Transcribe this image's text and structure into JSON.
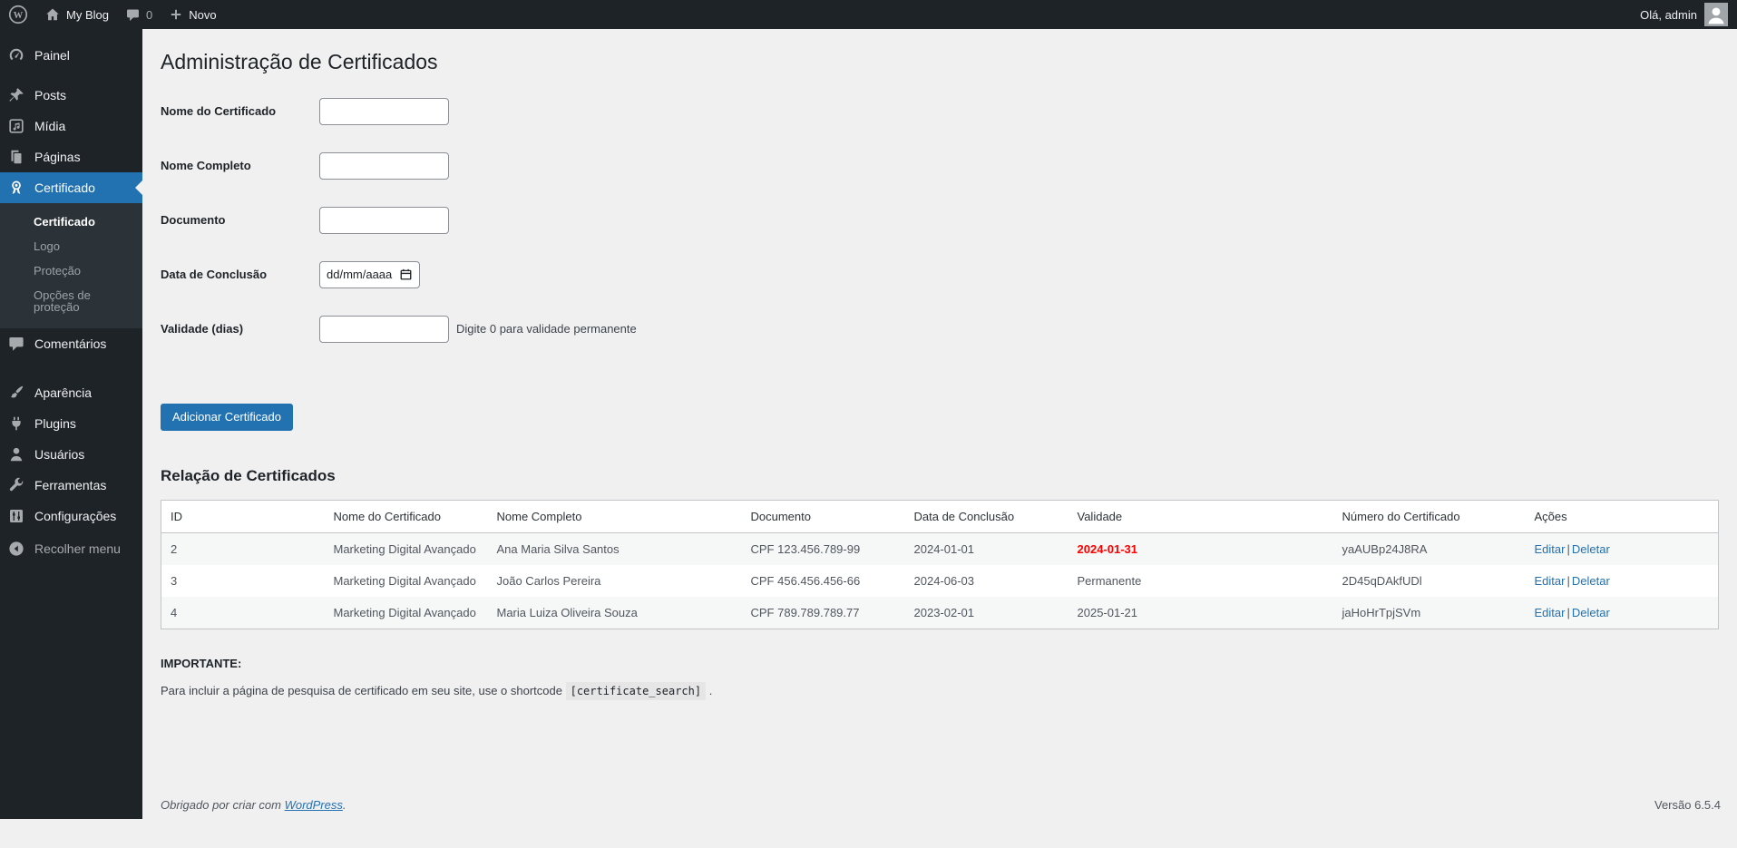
{
  "admin_bar": {
    "site_name": "My Blog",
    "comments_count": "0",
    "new_label": "Novo",
    "greeting": "Olá, admin"
  },
  "sidebar": {
    "items": [
      {
        "label": "Painel"
      },
      {
        "label": "Posts"
      },
      {
        "label": "Mídia"
      },
      {
        "label": "Páginas"
      },
      {
        "label": "Certificado"
      },
      {
        "label": "Comentários"
      },
      {
        "label": "Aparência"
      },
      {
        "label": "Plugins"
      },
      {
        "label": "Usuários"
      },
      {
        "label": "Ferramentas"
      },
      {
        "label": "Configurações"
      }
    ],
    "submenu": [
      {
        "label": "Certificado",
        "current": true
      },
      {
        "label": "Logo",
        "current": false
      },
      {
        "label": "Proteção",
        "current": false
      },
      {
        "label": "Opções de proteção",
        "current": false
      }
    ],
    "collapse_label": "Recolher menu"
  },
  "page": {
    "title": "Administração de Certificados",
    "form": {
      "fields": [
        {
          "label": "Nome do Certificado"
        },
        {
          "label": "Nome Completo"
        },
        {
          "label": "Documento"
        },
        {
          "label": "Data de Conclusão",
          "placeholder": "dd/mm/aaaa"
        },
        {
          "label": "Validade (dias)",
          "hint": "Digite 0 para validade permanente"
        }
      ],
      "submit_label": "Adicionar Certificado"
    }
  },
  "table": {
    "heading": "Relação de Certificados",
    "columns": [
      "ID",
      "Nome do Certificado",
      "Nome Completo",
      "Documento",
      "Data de Conclusão",
      "Validade",
      "Número do Certificado",
      "Ações"
    ],
    "action_separator": "|",
    "rows": [
      {
        "id": "2",
        "name": "Marketing Digital Avançado",
        "full_name": "Ana Maria Silva Santos",
        "document": "CPF 123.456.789-99",
        "completion_date": "2024-01-01",
        "validity": "2024-01-31",
        "validity_expired": true,
        "number": "yaAUBp24J8RA",
        "edit_label": "Editar",
        "delete_label": "Deletar"
      },
      {
        "id": "3",
        "name": "Marketing Digital Avançado",
        "full_name": "João Carlos Pereira",
        "document": "CPF 456.456.456-66",
        "completion_date": "2024-06-03",
        "validity": "Permanente",
        "validity_expired": false,
        "number": "2D45qDAkfUDl",
        "edit_label": "Editar",
        "delete_label": "Deletar"
      },
      {
        "id": "4",
        "name": "Marketing Digital Avançado",
        "full_name": "Maria Luiza Oliveira Souza",
        "document": "CPF 789.789.789.77",
        "completion_date": "2023-02-01",
        "validity": "2025-01-21",
        "validity_expired": false,
        "number": "jaHoHrTpjSVm",
        "edit_label": "Editar",
        "delete_label": "Deletar"
      }
    ]
  },
  "important": {
    "heading": "IMPORTANTE:",
    "text_before": "Para incluir a página de pesquisa de certificado em seu site, use o shortcode",
    "shortcode": "[certificate_search]",
    "text_after": "."
  },
  "footer": {
    "thanks_prefix": "Obrigado por criar com",
    "link_label": "WordPress",
    "thanks_suffix": ".",
    "version": "Versão 6.5.4"
  },
  "colors": {
    "admin_bar_bg": "#1d2327",
    "sidebar_bg": "#1d2327",
    "submenu_bg": "#2c3338",
    "accent_blue": "#2271b1",
    "content_bg": "#f0f0f1",
    "expired_red": "#ff0000",
    "table_border": "#c3c4c7",
    "stripe_bg": "#f6f7f7"
  }
}
